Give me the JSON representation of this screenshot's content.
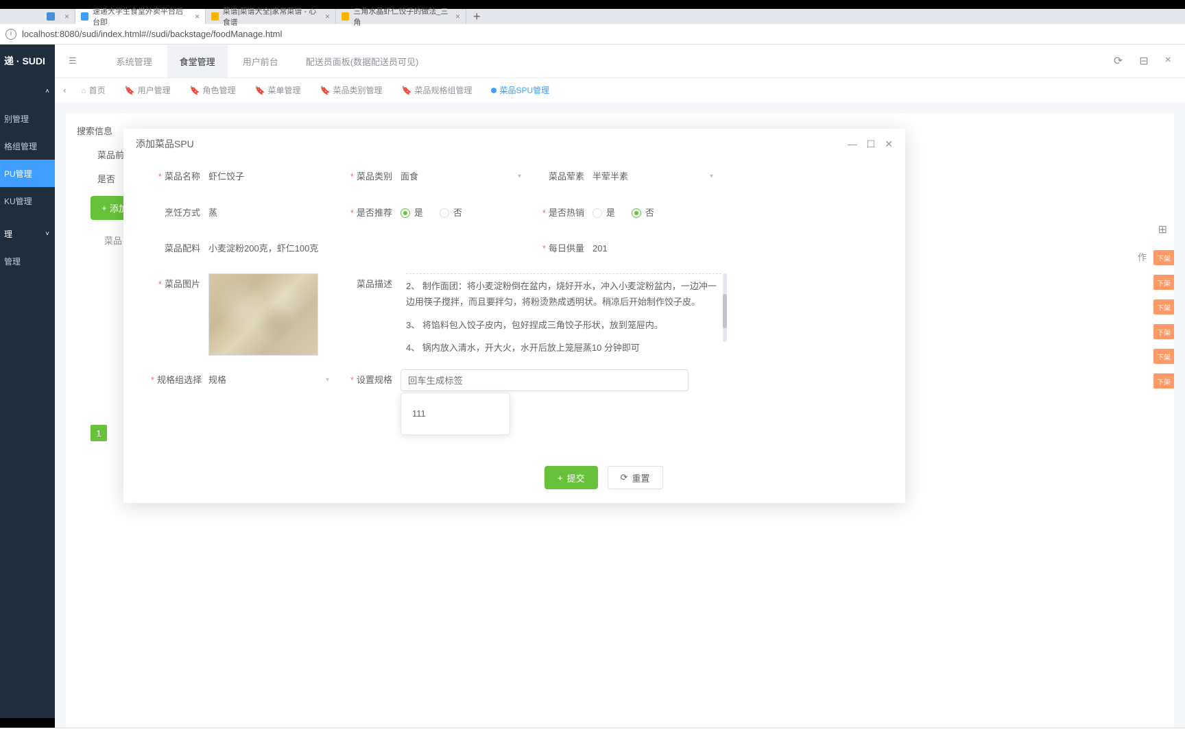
{
  "browser": {
    "tabs": [
      {
        "label": "",
        "favicon": "#4a90d9"
      },
      {
        "label": "速递大学生食堂外卖平台后台即",
        "favicon": "#409eff",
        "active": true
      },
      {
        "label": "菜谱|菜谱大全|家常菜谱 - 心食谱",
        "favicon": "#f7b500"
      },
      {
        "label": "三角水晶虾仁饺子的做法_三角",
        "favicon": "#f7b500"
      }
    ],
    "url": "localhost:8080/sudi/index.html#//sudi/backstage/foodManage.html"
  },
  "brand": "递 · SUDI",
  "sidebar": {
    "groups": [
      {
        "label": "",
        "chevron": "˄"
      },
      {
        "label": "别管理"
      },
      {
        "label": "格组管理"
      },
      {
        "label": "PU管理",
        "active": true
      },
      {
        "label": "KU管理"
      },
      {
        "label": "理",
        "chevron": "˅",
        "spaced": true
      },
      {
        "label": "管理"
      }
    ]
  },
  "topnav": {
    "items": [
      {
        "label": "系统管理"
      },
      {
        "label": "食堂管理",
        "active": true
      },
      {
        "label": "用户前台"
      },
      {
        "label": "配送员面板(数据配送员可见)"
      }
    ]
  },
  "subtabs": {
    "items": [
      {
        "label": "首页"
      },
      {
        "label": "用户管理"
      },
      {
        "label": "角色管理"
      },
      {
        "label": "菜单管理"
      },
      {
        "label": "菜品类别管理"
      },
      {
        "label": "菜品规格组管理"
      },
      {
        "label": "菜品SPU管理",
        "active": true
      }
    ]
  },
  "bgPanel": {
    "searchTitle": "搜索信息",
    "row1": "菜品前",
    "row2": "是否",
    "addBtn": "添加",
    "page": "1",
    "colHead": "菜品",
    "opHead": "作",
    "chips": [
      "下架",
      "下架",
      "下架",
      "下架",
      "下架",
      "下架"
    ]
  },
  "modal": {
    "title": "添加菜品SPU",
    "fields": {
      "name": {
        "label": "菜品名称",
        "value": "虾仁饺子"
      },
      "category": {
        "label": "菜品类别",
        "value": "面食"
      },
      "hunsu": {
        "label": "菜品荤素",
        "value": "半荤半素"
      },
      "cook": {
        "label": "烹饪方式",
        "value": "蒸"
      },
      "recommend": {
        "label": "是否推荐",
        "yes": "是",
        "no": "否"
      },
      "hot": {
        "label": "是否热销",
        "yes": "是",
        "no": "否"
      },
      "ingredients": {
        "label": "菜品配料",
        "value": "小麦淀粉200克，虾仁100克"
      },
      "daily": {
        "label": "每日供量",
        "value": "201"
      },
      "image": {
        "label": "菜品图片"
      },
      "desc": {
        "label": "菜品描述",
        "lines": [
          "2、 制作面团：将小麦淀粉倒在盆内，烧好开水，冲入小麦淀粉盆内，一边冲一边用筷子搅拌，而且要拌匀，将粉烫熟成透明状。稍凉后开始制作饺子皮。",
          "3、 将馅料包入饺子皮内，包好捏成三角饺子形状，放到笼屉内。",
          "4、 锅内放入清水，开大火，水开后放上笼屉蒸10 分钟即可"
        ]
      },
      "specGroup": {
        "label": "规格组选择",
        "value": "规格"
      },
      "setSpec": {
        "label": "设置规格",
        "placeholder": "回车生成标签"
      },
      "dropdownOption": "111"
    },
    "buttons": {
      "submit": "提交",
      "reset": "重置"
    }
  }
}
